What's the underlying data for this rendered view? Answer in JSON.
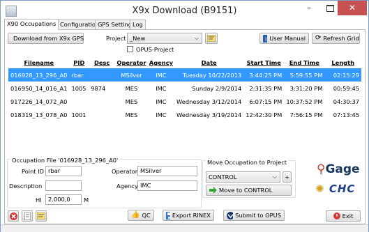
{
  "window": {
    "title": "X9x Download  (B9151)"
  },
  "tabs": [
    {
      "label": "X90 Occupations"
    },
    {
      "label": "Configuration"
    },
    {
      "label": "GPS Settings"
    },
    {
      "label": "Log"
    }
  ],
  "toolbar": {
    "download_label": "Download from X9x GPS",
    "project_label": "Project",
    "project_value": "_New",
    "opus_project_label": "OPUS-Project",
    "user_manual_label": "User Manual",
    "refresh_label": "Refresh Grid"
  },
  "grid": {
    "columns": [
      "Filename",
      "PID",
      "Desc",
      "Operator",
      "Agency",
      "Date",
      "Start Time",
      "End Time",
      "Length"
    ],
    "rows": [
      [
        "016928_13_296_A0",
        "rbar",
        "",
        "MSilver",
        "IMC",
        "Tuesday 10/22/2013",
        "3:44:25 PM",
        "5:59:55 PM",
        "02:15:29"
      ],
      [
        "016950_14_016_A1",
        "1005",
        "9874",
        "MES",
        "IMC",
        "Sunday 2/9/2014",
        "2:31:35 PM",
        "3:31:20 PM",
        "00:59:45"
      ],
      [
        "917226_14_072_A0",
        "",
        "",
        "MES",
        "IMC",
        "Wednesday 3/12/2014",
        "6:07:15 PM",
        "10:37:52 PM",
        "04:30:37"
      ],
      [
        "018319_13_078_A0",
        "1001",
        "",
        "MES",
        "IMC",
        "Wednesday 3/19/2014",
        "12:42:30 PM",
        "7:56:15 PM",
        "07:13:45"
      ]
    ]
  },
  "occupation": {
    "group_title": "Occupation File '016928_13_296_A0'",
    "point_id_label": "Point ID",
    "point_id_value": "rbar",
    "operator_label": "Operator",
    "operator_value": "MSilver",
    "description_label": "Description",
    "description_value": "",
    "agency_label": "Agency",
    "agency_value": "IMC",
    "hi_label": "HI",
    "hi_value": "2.000,0",
    "hi_unit": "M"
  },
  "move": {
    "group_title": "Move Occupation to Project",
    "select_value": "CONTROL",
    "plus_label": "+",
    "move_button_label": "Move to CONTROL"
  },
  "actions": {
    "qc_label": "QC",
    "export_label": "Export RINEX",
    "opus_label": "Submit to OPUS",
    "exit_label": "Exit"
  },
  "logos": {
    "igage": "iGage",
    "chc": "CHC"
  },
  "colors": {
    "selection": "#3399ff",
    "close": "#c75050"
  }
}
